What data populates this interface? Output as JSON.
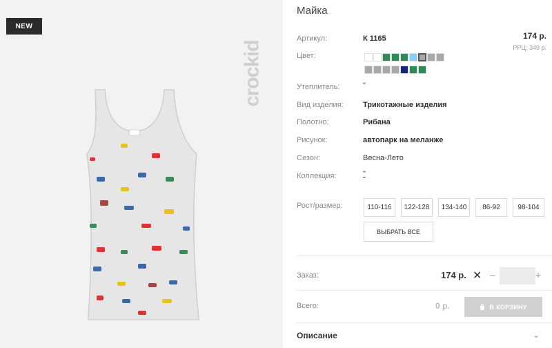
{
  "badge": "NEW",
  "logo_text": "crockid",
  "product": {
    "title": "Майка",
    "article_label": "Артикул:",
    "article": "К 1165",
    "price": "174 р.",
    "rrc": "РРЦ: 349 р.",
    "color_label": "Цвет:",
    "swatches_row1": [
      "#ffffff",
      "#ffffff",
      "#2e8b57",
      "#2e8b57",
      "#2e8b57",
      "#87cefa",
      "#a9a9a9",
      "#a9a9a9",
      "#a9a9a9"
    ],
    "swatches_row2": [
      "#a9a9a9",
      "#a9a9a9",
      "#a9a9a9",
      "#a9a9a9",
      "#1a237e",
      "#2e8b57",
      "#2e8b57"
    ],
    "insulation_label": "Утеплитель:",
    "insulation": "\"",
    "type_label": "Вид изделия:",
    "type": "Трикотажные изделия",
    "fabric_label": "Полотно:",
    "fabric": "Рибана",
    "pattern_label": "Рисунок:",
    "pattern": "автопарк на меланже",
    "season_label": "Сезон:",
    "season": "Весна-Лето",
    "collection_label": "Коллекция:",
    "collection": "\"",
    "size_label": "Рост/размер:",
    "sizes": [
      "110-116",
      "122-128",
      "134-140",
      "86-92",
      "98-104"
    ],
    "select_all": "ВЫБРАТЬ ВСЕ"
  },
  "order": {
    "label": "Заказ:",
    "price": "174 р.",
    "remove": "✕",
    "minus": "–",
    "plus": "+",
    "qty": ""
  },
  "total": {
    "label": "Всего:",
    "value": "0 р.",
    "cart_button": "В КОРЗИНУ"
  },
  "description": {
    "label": "Описание",
    "chevron": "⌄"
  }
}
